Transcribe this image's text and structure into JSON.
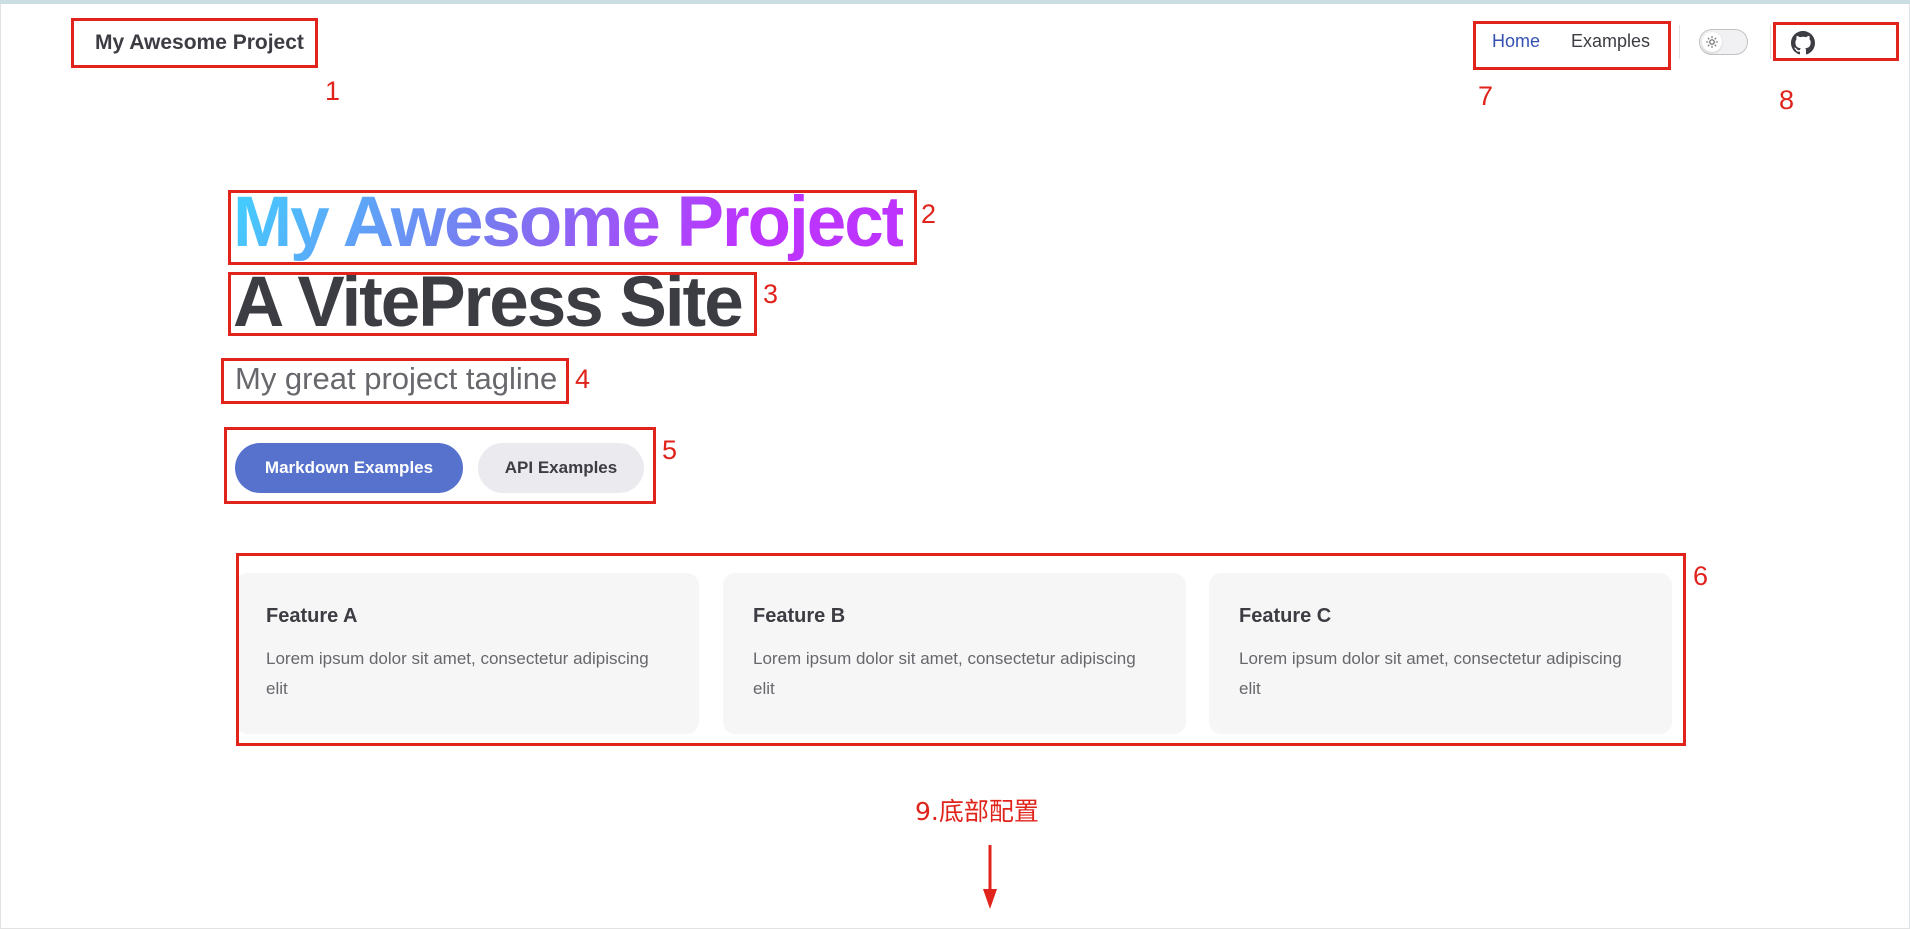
{
  "nav": {
    "site_title": "My Awesome Project",
    "links": [
      {
        "label": "Home",
        "active": true
      },
      {
        "label": "Examples",
        "active": false
      }
    ],
    "appearance_icon": "sun-icon",
    "social_icon": "github-icon"
  },
  "hero": {
    "name": "My Awesome Project",
    "text": "A VitePress Site",
    "tagline": "My great project tagline",
    "actions": [
      {
        "label": "Markdown Examples",
        "theme": "brand"
      },
      {
        "label": "API Examples",
        "theme": "alt"
      }
    ]
  },
  "features": [
    {
      "title": "Feature A",
      "details": "Lorem ipsum dolor sit amet, consectetur adipiscing elit"
    },
    {
      "title": "Feature B",
      "details": "Lorem ipsum dolor sit amet, consectetur adipiscing elit"
    },
    {
      "title": "Feature C",
      "details": "Lorem ipsum dolor sit amet, consectetur adipiscing elit"
    }
  ],
  "annotations": {
    "labels": [
      "1",
      "2",
      "3",
      "4",
      "5",
      "6",
      "7",
      "8"
    ],
    "footer_note": "9.底部配置",
    "color": "#e0231b"
  },
  "colors": {
    "brand": "#5672cd",
    "active_link": "#3451b2",
    "gradient_start": "#41d1ff",
    "gradient_end": "#bd34fe"
  }
}
